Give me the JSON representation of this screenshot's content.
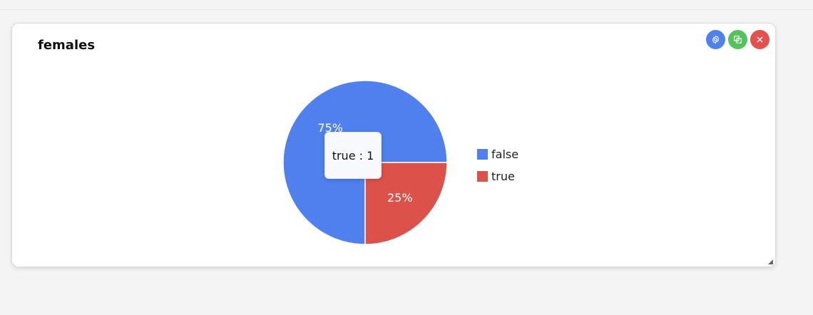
{
  "panel": {
    "title": "females"
  },
  "toolbar": {
    "settings_icon": "gear-icon",
    "duplicate_icon": "copy-icon",
    "close_icon": "close-icon",
    "settings_color": "#4f80ee",
    "duplicate_color": "#55c25b",
    "close_color": "#e4514c"
  },
  "tooltip": {
    "text": "true : 1"
  },
  "chart_data": {
    "type": "pie",
    "categories": [
      "false",
      "true"
    ],
    "values": [
      3,
      1
    ],
    "slice_labels": [
      "75%",
      "25%"
    ],
    "colors": [
      "#4f80ee",
      "#dc524a"
    ],
    "legend_position": "right"
  }
}
